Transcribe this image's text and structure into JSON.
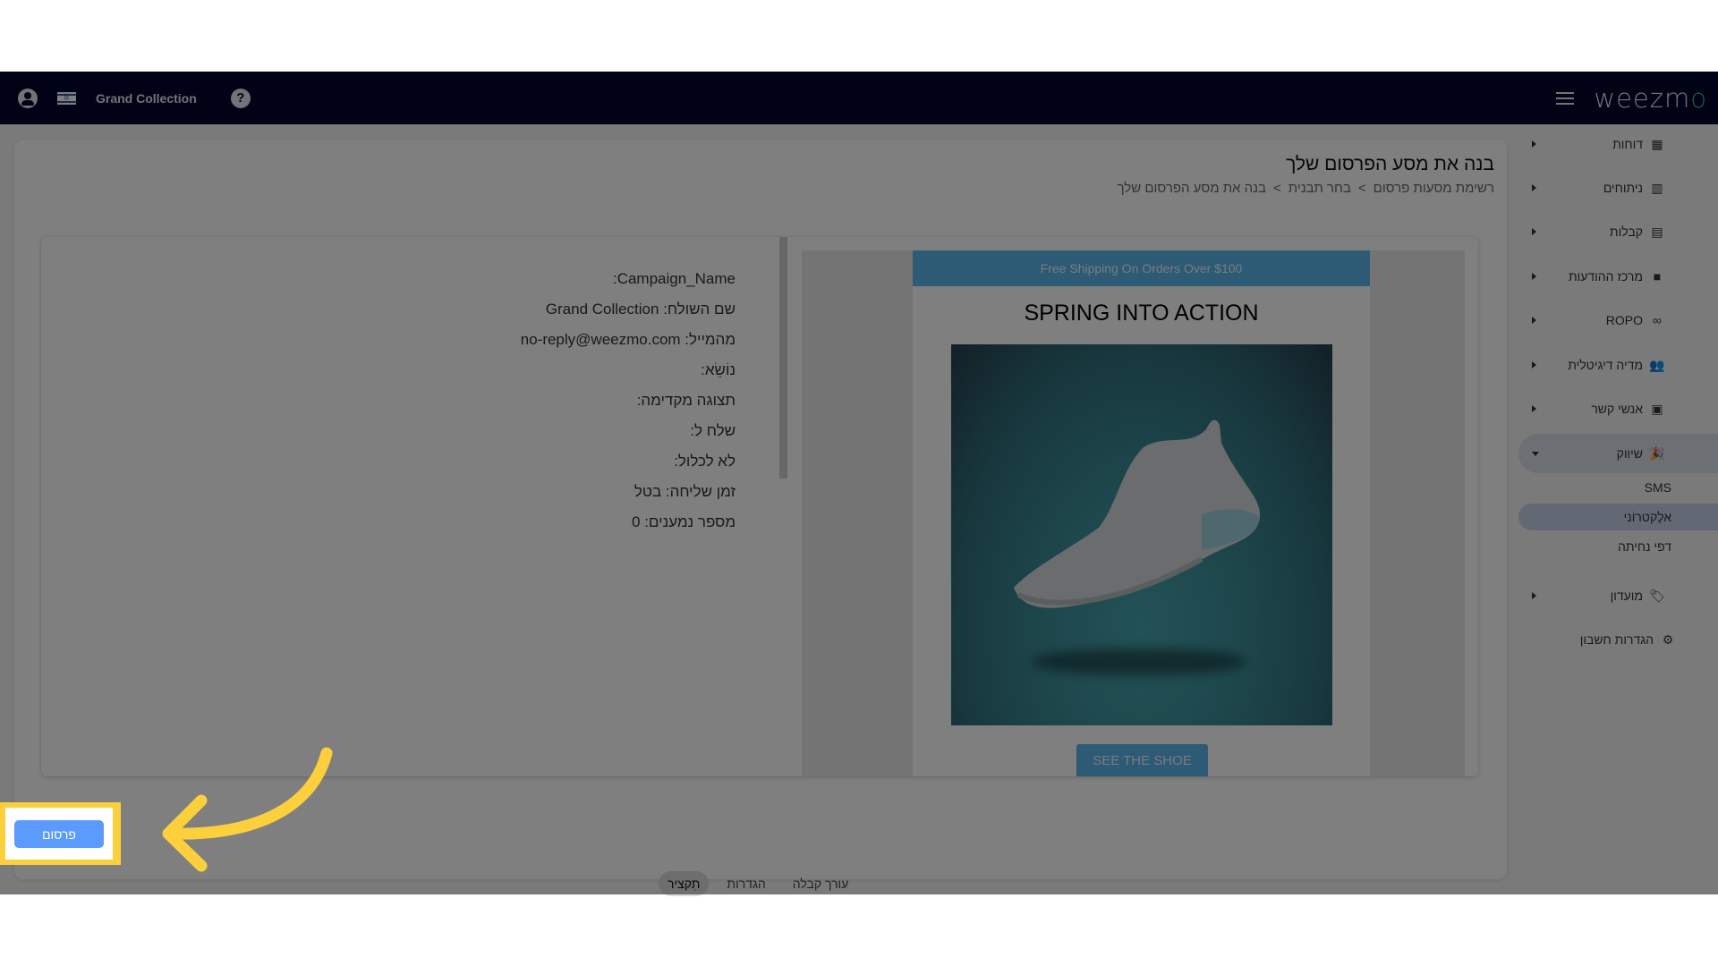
{
  "navbar": {
    "account_name": "Grand Collection",
    "logo_text": "weezm",
    "logo_accent": "o",
    "help_label": "?"
  },
  "sidebar": {
    "items": [
      {
        "label": "דוחות",
        "icon": "dashboard-icon"
      },
      {
        "label": "ניתוחים",
        "icon": "analytics-icon"
      },
      {
        "label": "קבלות",
        "icon": "receipt-icon"
      },
      {
        "label": "מרכז ההודעות",
        "icon": "chat-icon"
      },
      {
        "label": "ROPO",
        "icon": "infinity-icon"
      },
      {
        "label": "מדיה דיגיטלית",
        "icon": "people-icon"
      },
      {
        "label": "אנשי קשר",
        "icon": "contact-icon"
      },
      {
        "label": "שיווק",
        "icon": "party-popper-icon",
        "expanded": true
      },
      {
        "label": "מועדון",
        "icon": "tag-icon"
      },
      {
        "label": "הגדרות חשבון",
        "icon": "gear-icon"
      }
    ],
    "marketing_subitems": [
      {
        "label": "SMS"
      },
      {
        "label": "אלֶקטרוֹני",
        "active": true
      },
      {
        "label": "דפי נחיתה"
      }
    ]
  },
  "page": {
    "title": "בנה את מסע הפרסום שלך",
    "breadcrumb": [
      "רשימת מסעות פרסום",
      "בחר תבנית",
      "בנה את מסע הפרסום שלך"
    ],
    "breadcrumb_separator": ">"
  },
  "summary": {
    "lines": [
      "Campaign_Name:",
      "שם השולח: Grand Collection",
      "מהמייל: no-reply@weezmo.com",
      "נוֹשֵׂא:",
      "תצוגה מקדימה:",
      "שלח ל:",
      "לא לכלול:",
      "זמן שליחה: בטל",
      "מספר נמענים: 0"
    ]
  },
  "email_preview": {
    "banner": "Free Shipping On Orders Over $100",
    "heading": "SPRING INTO ACTION",
    "image_alt": "shoe-image",
    "cta": "SEE THE SHOE",
    "brand_color": "#5bb4ea"
  },
  "tabs": [
    {
      "label": "עורך קבלה",
      "active": false
    },
    {
      "label": "הגדרות",
      "active": false
    },
    {
      "label": "תִקציר",
      "active": true
    }
  ],
  "actions": {
    "publish_label": "פרסום"
  },
  "colors": {
    "navbar": "#05052e",
    "highlight": "#fcd03c",
    "publish": "#5b9bff"
  }
}
